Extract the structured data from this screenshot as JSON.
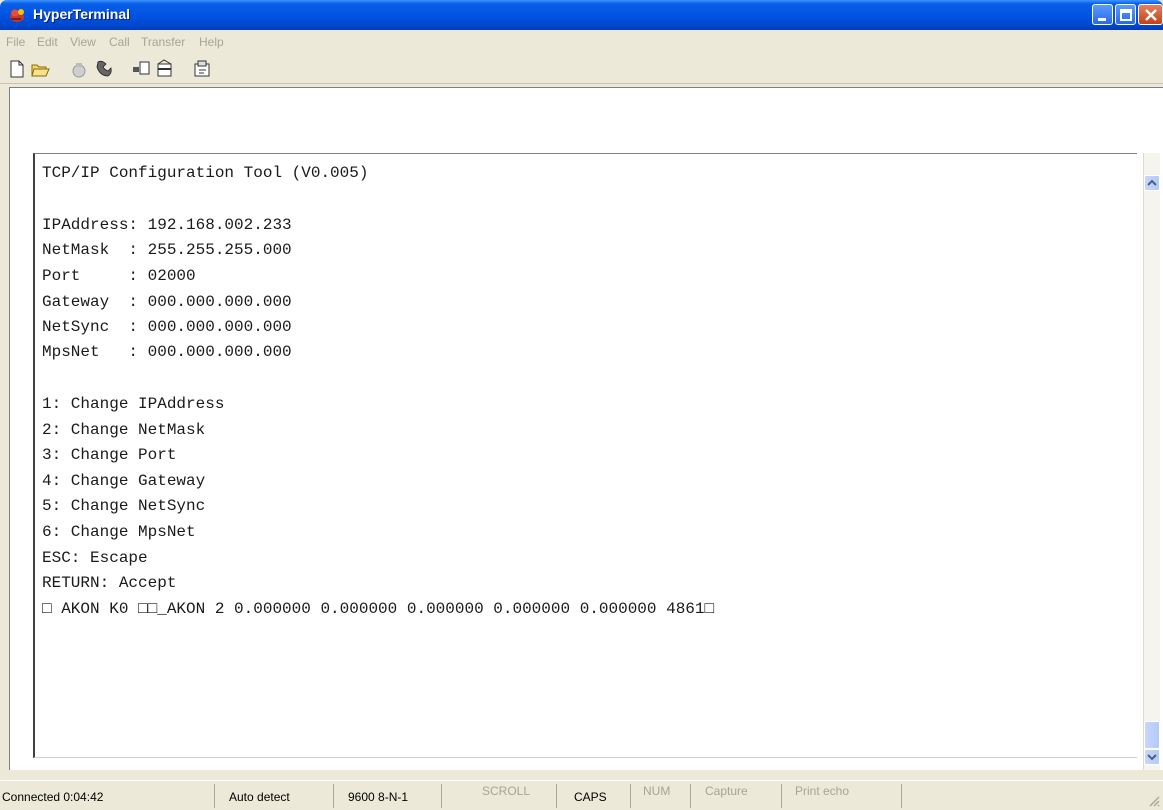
{
  "window": {
    "title": "HyperTerminal",
    "accent_color": "#0054e3",
    "icon": "hyperterminal-phone-icon"
  },
  "menu": {
    "items": [
      "File",
      "Edit",
      "View",
      "Call",
      "Transfer",
      "Help"
    ]
  },
  "toolbar": {
    "icons": [
      "new-connection-icon",
      "open-icon",
      "disconnect-icon",
      "dial-icon",
      "send-icon",
      "receive-icon",
      "properties-icon"
    ]
  },
  "terminal": {
    "lines": [
      "TCP/IP Configuration Tool (V0.005)",
      "",
      "IPAddress: 192.168.002.233",
      "NetMask  : 255.255.255.000",
      "Port     : 02000",
      "Gateway  : 000.000.000.000",
      "NetSync  : 000.000.000.000",
      "MpsNet   : 000.000.000.000",
      "",
      "1: Change IPAddress",
      "2: Change NetMask",
      "3: Change Port",
      "4: Change Gateway",
      "5: Change NetSync",
      "6: Change MpsNet",
      "ESC: Escape",
      "RETURN: Accept",
      "□ AKON K0 □□_AKON 2 0.000000 0.000000 0.000000 0.000000 0.000000 4861□"
    ]
  },
  "status": {
    "connected": "Connected 0:04:42",
    "detect": "Auto detect",
    "settings": "9600 8-N-1",
    "scroll": "SCROLL",
    "caps": "CAPS",
    "num": "NUM",
    "capture": "Capture",
    "print_echo": "Print echo"
  }
}
